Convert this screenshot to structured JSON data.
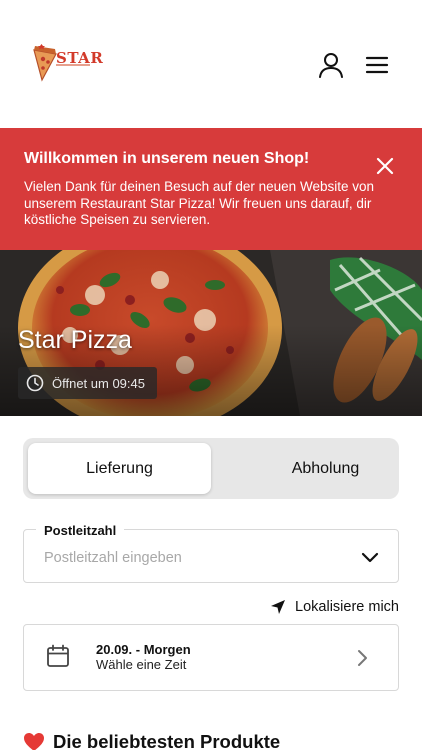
{
  "header": {
    "logo_text": "STAR",
    "account_icon": "user-icon",
    "menu_icon": "hamburger-menu-icon"
  },
  "banner": {
    "title": "Willkommen in unserem neuen Shop!",
    "text": "Vielen Dank für deinen Besuch auf der neuen Website von unserem Restaurant Star Pizza! Wir freuen uns darauf, dir köstliche Speisen zu servieren.",
    "close_icon": "close-icon",
    "background": "#d73b3b"
  },
  "hero": {
    "restaurant_name": "Star Pizza",
    "opening_status": "Öffnet um 09:45",
    "clock_icon": "clock-icon"
  },
  "order_mode": {
    "options": [
      "Lieferung",
      "Abholung"
    ],
    "selected": "Lieferung"
  },
  "zip": {
    "label": "Postleitzahl",
    "placeholder": "Postleitzahl eingeben",
    "chevron_icon": "chevron-down-icon"
  },
  "locate": {
    "label": "Lokalisiere mich",
    "icon": "location-arrow-icon"
  },
  "time_slot": {
    "date": "20.09. - Morgen",
    "hint": "Wähle eine Zeit",
    "calendar_icon": "calendar-icon",
    "chevron_icon": "chevron-right-icon"
  },
  "popular": {
    "heading": "Die beliebtesten Produkte",
    "icon": "heart-icon",
    "icon_color": "#e53935"
  }
}
